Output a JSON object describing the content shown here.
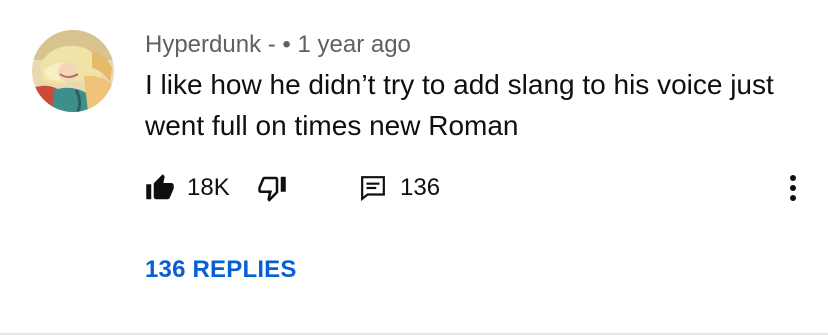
{
  "comment": {
    "author": "Hyperdunk -",
    "separator": "•",
    "time": "1 year ago",
    "text": "I like how he didn’t try to add slang to his voice just went full on times new Roman"
  },
  "actions": {
    "like_icon": "thumbs-up-filled-icon",
    "like_count": "18K",
    "dislike_icon": "thumbs-down-outline-icon",
    "reply_icon": "reply-bubble-icon",
    "reply_count": "136",
    "more_icon": "more-vertical-icon"
  },
  "replies": {
    "label": "136 REPLIES"
  },
  "colors": {
    "meta_text": "#606060",
    "primary_text": "#0f0f0f",
    "link": "#065fd4",
    "divider": "#e5e5e5"
  }
}
